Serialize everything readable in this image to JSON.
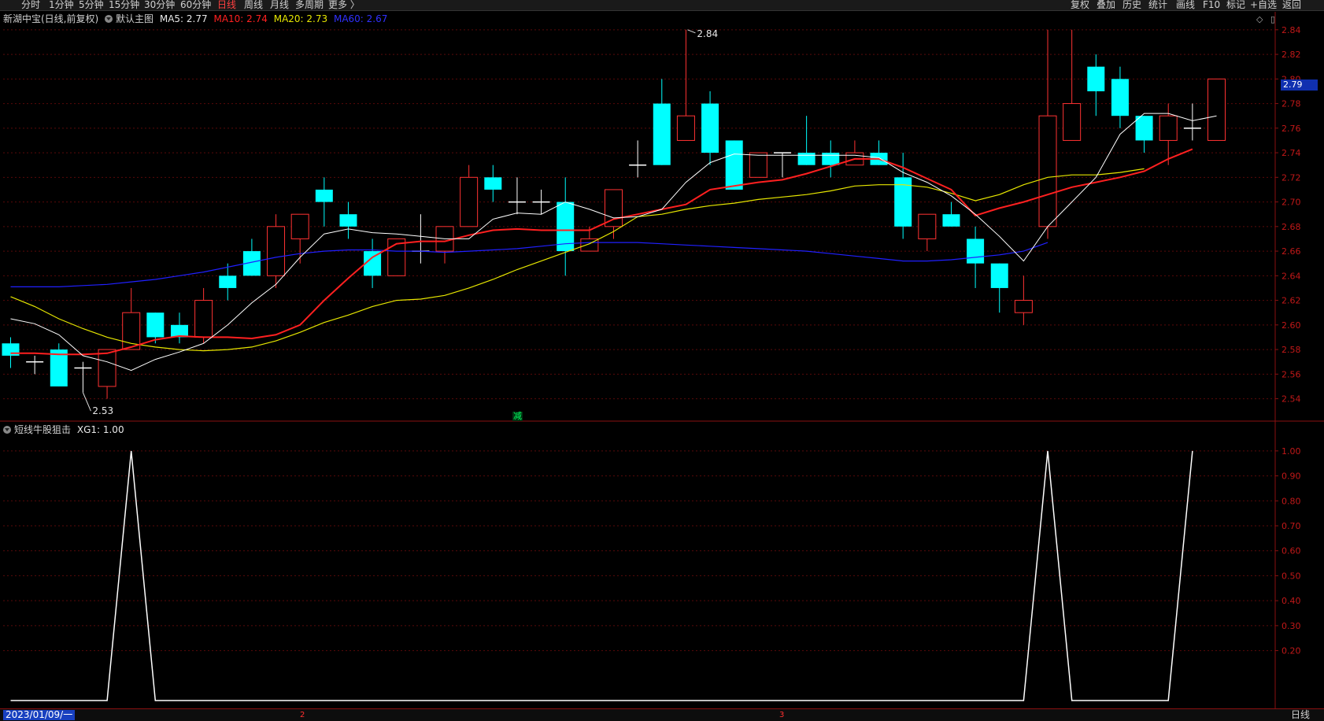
{
  "toolbar": {
    "left": [
      "分时",
      "1分钟",
      "5分钟",
      "15分钟",
      "30分钟",
      "60分钟",
      "日线",
      "周线",
      "月线",
      "多周期",
      "更多 〉"
    ],
    "active": "日线",
    "right": [
      "复权",
      "叠加",
      "历史",
      "统计",
      "画线",
      "F10",
      "标记",
      "+自选",
      "返回"
    ]
  },
  "main_title": {
    "stock": "新湖中宝(日线,前复权)",
    "template": "默认主图",
    "ma5": "MA5: 2.77",
    "ma10": "MA10: 2.74",
    "ma20": "MA20: 2.73",
    "ma60": "MA60: 2.67"
  },
  "indicator_title": {
    "name": "短线牛股狙击",
    "value": "XG1: 1.00"
  },
  "price_tag": "2.79",
  "marker": "减",
  "bottom": {
    "date": "2023/01/09/一",
    "months": [
      "2",
      "3"
    ],
    "period": "日线"
  },
  "colors": {
    "up": "#ff3232",
    "down": "#00ffff",
    "ma5": "#ffffff",
    "ma10": "#ff2020",
    "ma20": "#e6e600",
    "ma60": "#2020ff",
    "axis": "#8a1010",
    "grid": "#5a0a0a"
  },
  "chart_data": {
    "type": "candlestick",
    "ylim": [
      2.525,
      2.845
    ],
    "yticks": [
      "2.84",
      "2.82",
      "2.80",
      "2.78",
      "2.76",
      "2.74",
      "2.72",
      "2.70",
      "2.68",
      "2.66",
      "2.64",
      "2.62",
      "2.60",
      "2.58",
      "2.56",
      "2.54"
    ],
    "annotations": {
      "high": "2.84",
      "low": "2.53"
    },
    "candles": [
      [
        2.585,
        2.575,
        2.59,
        2.565
      ],
      [
        2.57,
        2.57,
        2.575,
        2.56
      ],
      [
        2.58,
        2.55,
        2.585,
        2.55
      ],
      [
        2.565,
        2.565,
        2.57,
        2.545
      ],
      [
        2.55,
        2.58,
        2.58,
        2.54
      ],
      [
        2.58,
        2.61,
        2.63,
        2.58
      ],
      [
        2.61,
        2.59,
        2.61,
        2.585
      ],
      [
        2.6,
        2.59,
        2.61,
        2.585
      ],
      [
        2.59,
        2.62,
        2.63,
        2.585
      ],
      [
        2.64,
        2.63,
        2.65,
        2.62
      ],
      [
        2.66,
        2.64,
        2.67,
        2.64
      ],
      [
        2.64,
        2.68,
        2.69,
        2.63
      ],
      [
        2.67,
        2.69,
        2.69,
        2.65
      ],
      [
        2.71,
        2.7,
        2.72,
        2.68
      ],
      [
        2.69,
        2.68,
        2.7,
        2.67
      ],
      [
        2.66,
        2.64,
        2.67,
        2.63
      ],
      [
        2.64,
        2.67,
        2.67,
        2.64
      ],
      [
        2.66,
        2.66,
        2.69,
        2.65
      ],
      [
        2.66,
        2.68,
        2.68,
        2.65
      ],
      [
        2.68,
        2.72,
        2.73,
        2.68
      ],
      [
        2.72,
        2.71,
        2.73,
        2.7
      ],
      [
        2.7,
        2.7,
        2.72,
        2.69
      ],
      [
        2.7,
        2.7,
        2.71,
        2.69
      ],
      [
        2.7,
        2.66,
        2.72,
        2.64
      ],
      [
        2.66,
        2.67,
        2.68,
        2.66
      ],
      [
        2.68,
        2.71,
        2.71,
        2.67
      ],
      [
        2.73,
        2.73,
        2.75,
        2.72
      ],
      [
        2.78,
        2.73,
        2.8,
        2.73
      ],
      [
        2.75,
        2.77,
        2.84,
        2.75
      ],
      [
        2.78,
        2.74,
        2.79,
        2.73
      ],
      [
        2.75,
        2.71,
        2.75,
        2.71
      ],
      [
        2.72,
        2.74,
        2.74,
        2.72
      ],
      [
        2.74,
        2.74,
        2.74,
        2.72
      ],
      [
        2.74,
        2.73,
        2.77,
        2.73
      ],
      [
        2.74,
        2.73,
        2.75,
        2.72
      ],
      [
        2.73,
        2.74,
        2.75,
        2.73
      ],
      [
        2.74,
        2.73,
        2.75,
        2.73
      ],
      [
        2.72,
        2.68,
        2.74,
        2.67
      ],
      [
        2.67,
        2.69,
        2.69,
        2.66
      ],
      [
        2.69,
        2.68,
        2.7,
        2.68
      ],
      [
        2.67,
        2.65,
        2.68,
        2.63
      ],
      [
        2.65,
        2.63,
        2.65,
        2.61
      ],
      [
        2.61,
        2.62,
        2.64,
        2.6
      ],
      [
        2.68,
        2.77,
        2.84,
        2.67
      ],
      [
        2.75,
        2.78,
        2.84,
        2.75
      ],
      [
        2.81,
        2.79,
        2.82,
        2.77
      ],
      [
        2.8,
        2.77,
        2.81,
        2.76
      ],
      [
        2.77,
        2.75,
        2.77,
        2.74
      ],
      [
        2.75,
        2.77,
        2.78,
        2.73
      ],
      [
        2.76,
        2.76,
        2.78,
        2.75
      ],
      [
        2.75,
        2.8,
        2.8,
        2.75
      ]
    ],
    "ma5": [
      2.605,
      2.601,
      2.592,
      2.575,
      2.57,
      2.563,
      2.572,
      2.578,
      2.585,
      2.6,
      2.618,
      2.633,
      2.655,
      2.674,
      2.678,
      2.675,
      2.674,
      2.672,
      2.67,
      2.67,
      2.686,
      2.691,
      2.69,
      2.7,
      2.694,
      2.687,
      2.688,
      2.694,
      2.716,
      2.732,
      2.739,
      2.738,
      2.738,
      2.738,
      2.738,
      2.738,
      2.736,
      2.724,
      2.716,
      2.705,
      2.69,
      2.672,
      2.652,
      2.68,
      2.7,
      2.72,
      2.755,
      2.772,
      2.772,
      2.766,
      2.77
    ],
    "ma10": [
      2.577,
      2.577,
      2.576,
      2.576,
      2.577,
      2.582,
      2.588,
      2.591,
      2.59,
      2.59,
      2.589,
      2.592,
      2.6,
      2.62,
      2.638,
      2.655,
      2.666,
      2.668,
      2.668,
      2.673,
      2.677,
      2.678,
      2.677,
      2.677,
      2.677,
      2.686,
      2.69,
      2.694,
      2.698,
      2.71,
      2.713,
      2.716,
      2.718,
      2.723,
      2.729,
      2.735,
      2.735,
      2.728,
      2.719,
      2.71,
      2.689,
      2.695,
      2.7,
      2.706,
      2.712,
      2.716,
      2.72,
      2.725,
      2.735,
      2.743
    ],
    "ma20": [
      2.623,
      2.615,
      2.605,
      2.597,
      2.59,
      2.585,
      2.582,
      2.58,
      2.579,
      2.58,
      2.582,
      2.587,
      2.594,
      2.602,
      2.608,
      2.615,
      2.62,
      2.621,
      2.624,
      2.63,
      2.637,
      2.645,
      2.652,
      2.659,
      2.666,
      2.676,
      2.688,
      2.69,
      2.694,
      2.697,
      2.699,
      2.702,
      2.704,
      2.706,
      2.709,
      2.713,
      2.714,
      2.714,
      2.712,
      2.707,
      2.701,
      2.706,
      2.714,
      2.72,
      2.722,
      2.722,
      2.724,
      2.727
    ],
    "ma60": [
      2.631,
      2.631,
      2.631,
      2.632,
      2.633,
      2.635,
      2.637,
      2.64,
      2.643,
      2.647,
      2.651,
      2.655,
      2.658,
      2.66,
      2.661,
      2.661,
      2.66,
      2.66,
      2.659,
      2.66,
      2.661,
      2.662,
      2.664,
      2.666,
      2.667,
      2.667,
      2.667,
      2.666,
      2.665,
      2.664,
      2.663,
      2.662,
      2.661,
      2.66,
      2.658,
      2.656,
      2.654,
      2.652,
      2.652,
      2.653,
      2.655,
      2.657,
      2.66,
      2.667
    ],
    "indicator": {
      "name": "XG1",
      "ylim": [
        0,
        1.05
      ],
      "yticks": [
        "1.00",
        "0.90",
        "0.80",
        "0.70",
        "0.60",
        "0.50",
        "0.40",
        "0.30",
        "0.20"
      ],
      "values": [
        0,
        0,
        0,
        0,
        0,
        1,
        0,
        0,
        0,
        0,
        0,
        0,
        0,
        0,
        0,
        0,
        0,
        0,
        0,
        0,
        0,
        0,
        0,
        0,
        0,
        0,
        0,
        0,
        0,
        0,
        0,
        0,
        0,
        0,
        0,
        0,
        0,
        0,
        0,
        0,
        0,
        0,
        0,
        1,
        0,
        0,
        0,
        0,
        0,
        1
      ]
    }
  }
}
